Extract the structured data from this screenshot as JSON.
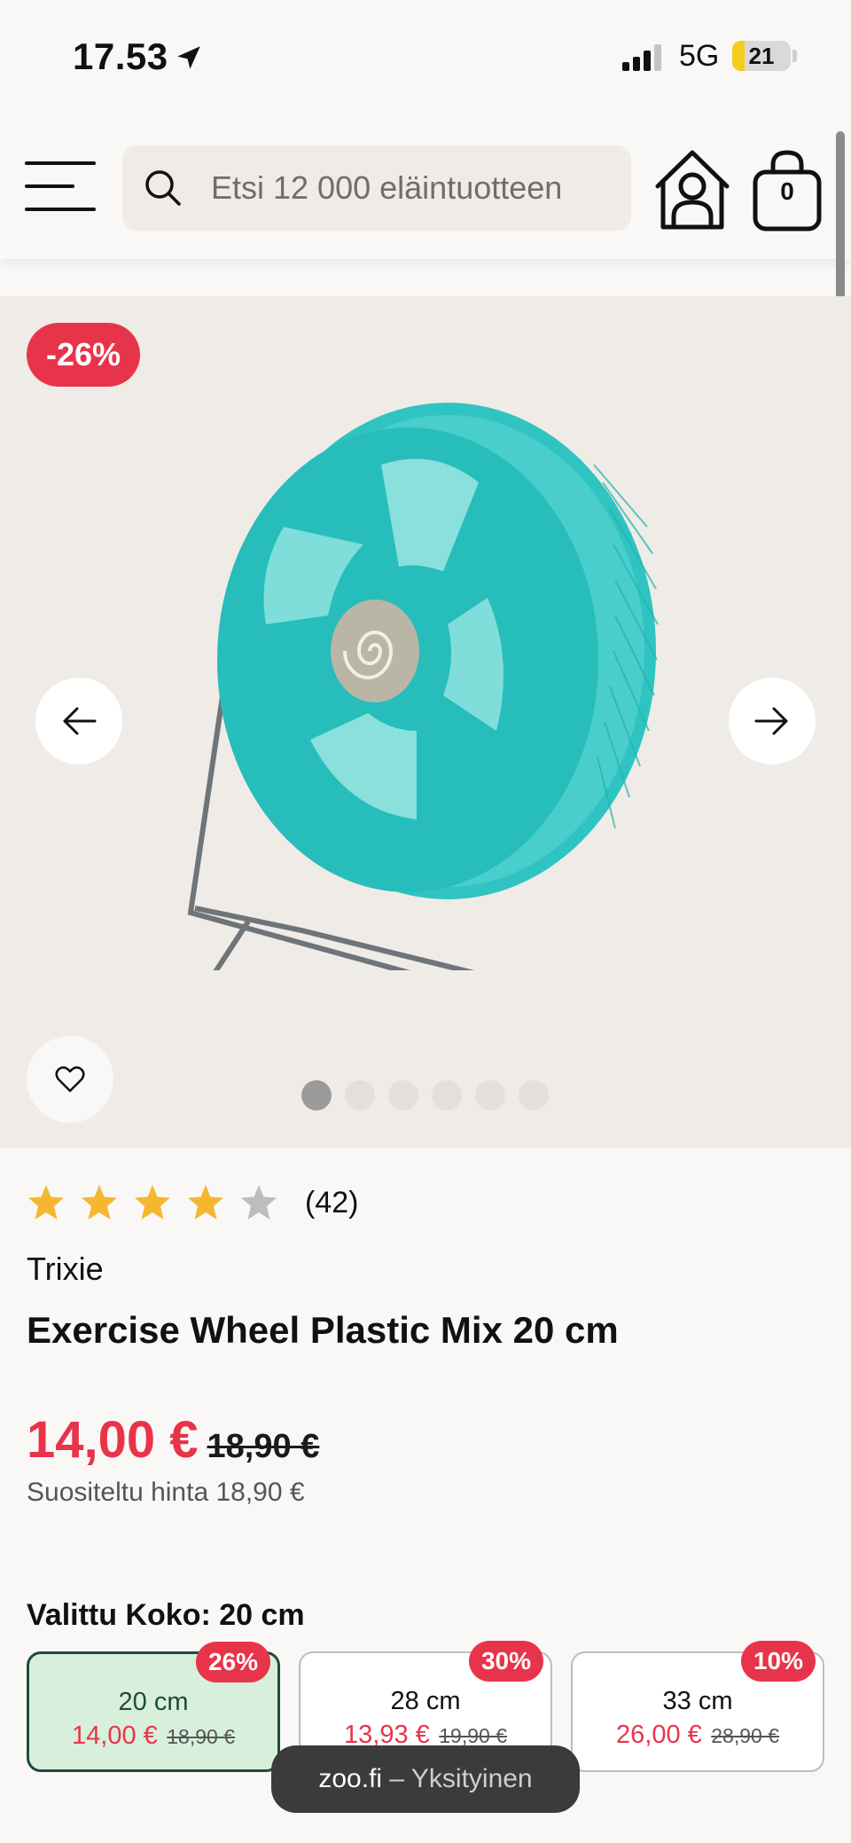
{
  "status_bar": {
    "time": "17.53",
    "network": "5G",
    "battery": "21",
    "battery_level": 0.21
  },
  "header": {
    "search_placeholder": "Etsi 12 000 eläintuotteen",
    "cart_count": "0"
  },
  "gallery": {
    "discount": "-26%",
    "image_count": 6,
    "active_index": 0
  },
  "product": {
    "rating": 4,
    "rating_max": 5,
    "review_count": "(42)",
    "brand": "Trixie",
    "title": "Exercise Wheel Plastic Mix 20 cm",
    "price_now": "14,00 €",
    "price_old": "18,90 €",
    "price_recommended": "Suositeltu hinta 18,90 €"
  },
  "size_selector": {
    "label": "Valittu Koko: 20 cm",
    "variants": [
      {
        "badge": "26%",
        "size": "20 cm",
        "price_now": "14,00 €",
        "price_old": "18,90 €",
        "selected": true
      },
      {
        "badge": "30%",
        "size": "28 cm",
        "price_now": "13,93 €",
        "price_old": "19,90 €",
        "selected": false
      },
      {
        "badge": "10%",
        "size": "33 cm",
        "price_now": "26,00 €",
        "price_old": "28,90 €",
        "selected": false
      }
    ]
  },
  "toast": {
    "domain": "zoo.fi",
    "mode": " – Yksityinen"
  },
  "colors": {
    "accent_red": "#e8344a",
    "selected_green": "#d8efdc",
    "star": "#f5b731"
  }
}
